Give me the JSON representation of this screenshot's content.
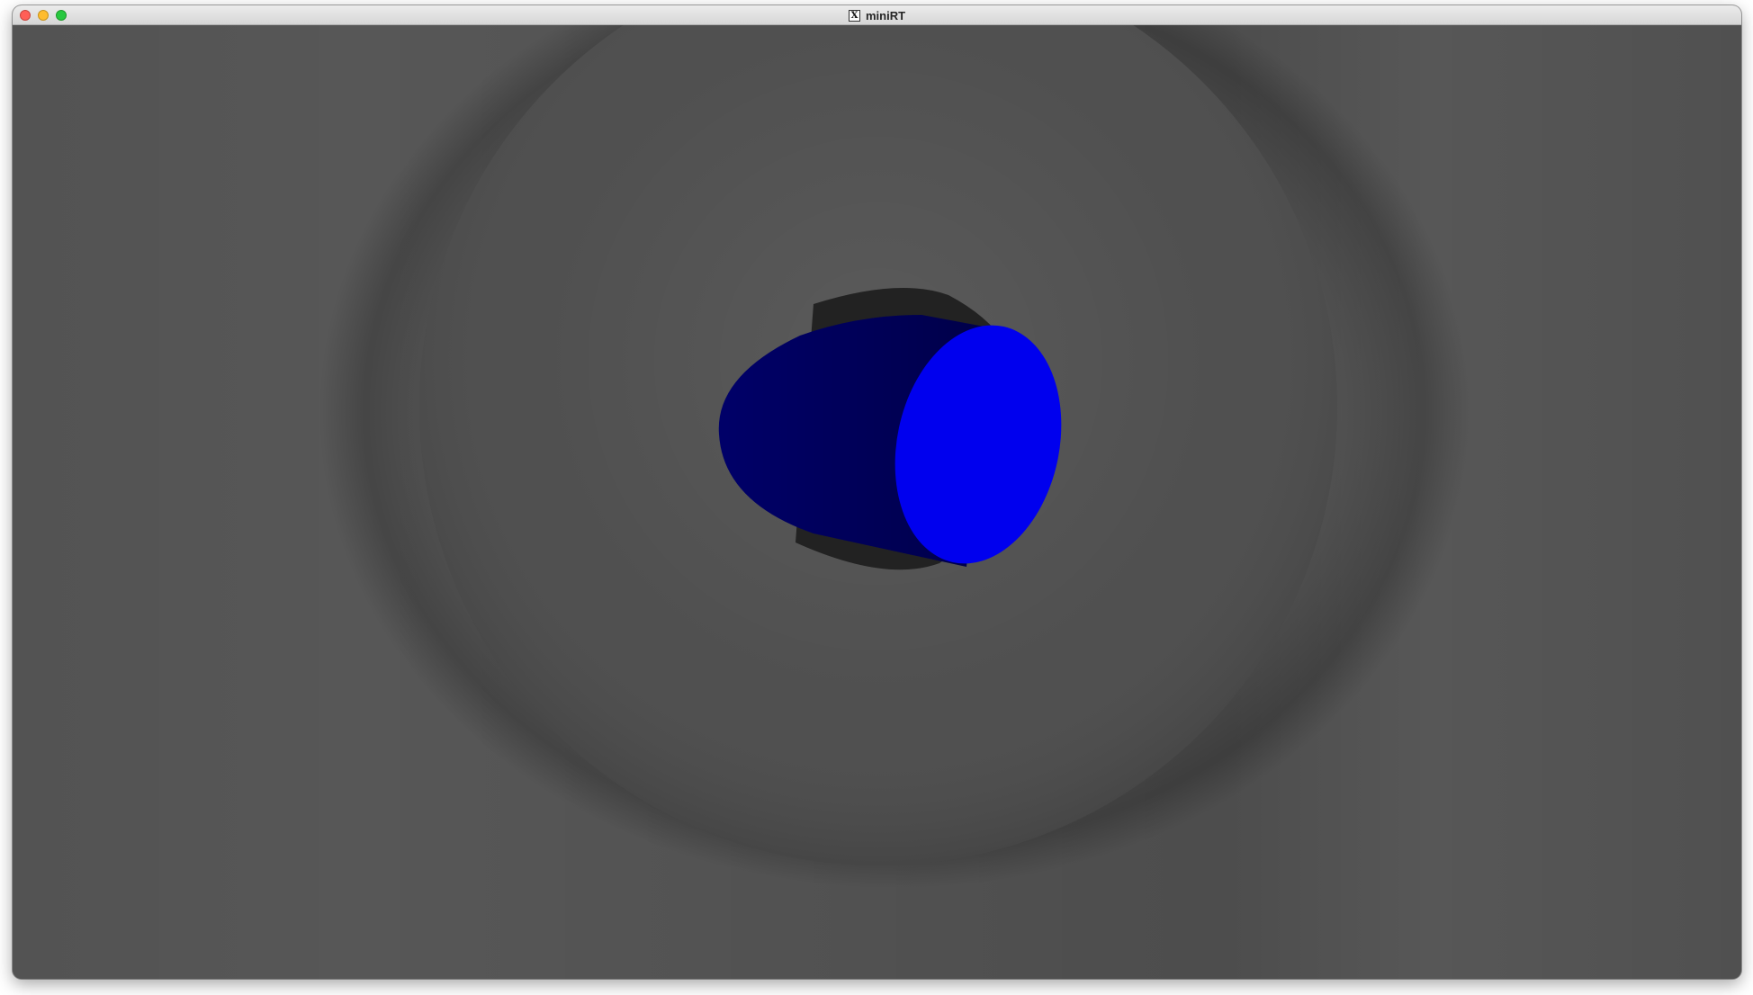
{
  "window": {
    "title": "miniRT",
    "title_icon": "x11-icon",
    "title_icon_glyph": "X",
    "controls": [
      {
        "name": "close-button",
        "color": "#ff5f57"
      },
      {
        "name": "minimize-button",
        "color": "#febc2e"
      },
      {
        "name": "zoom-button",
        "color": "#28c840"
      }
    ]
  },
  "scene": {
    "background_color": "#575757",
    "plane_color": "#5f5f5f",
    "shadow_color": "#3c3c3c",
    "disc_color": "#4c4c4c",
    "cylinder_body_color": "#00006e",
    "cylinder_cap_color": "#0000ee",
    "cylinder_shadow_color": "#222222"
  }
}
